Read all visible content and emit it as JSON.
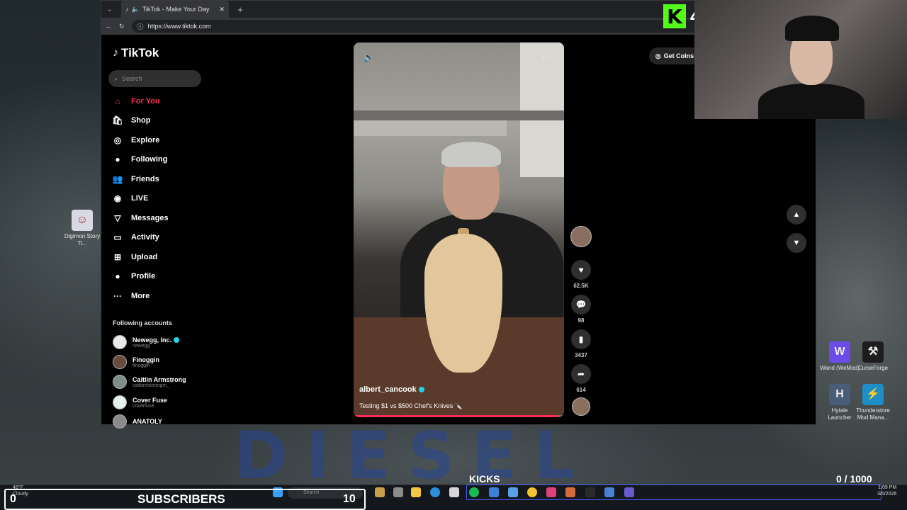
{
  "browser": {
    "tab_title": "TikTok - Make Your Day",
    "url": "https://www.tiktok.com"
  },
  "sidebar": {
    "logo": "TikTok",
    "search_placeholder": "Search",
    "nav": [
      {
        "label": "For You",
        "icon": "home-icon"
      },
      {
        "label": "Shop",
        "icon": "shop-bag-icon"
      },
      {
        "label": "Explore",
        "icon": "compass-icon"
      },
      {
        "label": "Following",
        "icon": "avatar-icon"
      },
      {
        "label": "Friends",
        "icon": "friends-icon"
      },
      {
        "label": "LIVE",
        "icon": "live-icon"
      },
      {
        "label": "Messages",
        "icon": "paper-plane-icon"
      },
      {
        "label": "Activity",
        "icon": "inbox-icon"
      },
      {
        "label": "Upload",
        "icon": "plus-square-icon"
      },
      {
        "label": "Profile",
        "icon": "avatar-icon"
      },
      {
        "label": "More",
        "icon": "ellipsis-icon"
      }
    ],
    "following_title": "Following accounts",
    "accounts": [
      {
        "name": "Newegg, Inc.",
        "handle": "newegg"
      },
      {
        "name": "Finoggin",
        "handle": "finoggin"
      },
      {
        "name": "Caitlin Armstrong",
        "handle": "caitarmstrongm_"
      },
      {
        "name": "Cover Fuse",
        "handle": "coverfuse"
      },
      {
        "name": "ANATOLY",
        "handle": ""
      }
    ]
  },
  "video": {
    "author": "albert_cancook",
    "caption": "Testing $1 vs $500 Chef's Knives 🔪",
    "progress": 0.97
  },
  "actions": {
    "likes": "62.5K",
    "comments": "98",
    "saves": "3437",
    "shares": "614"
  },
  "get_coins": "Get Coins",
  "overlay": {
    "kick_logo": "K",
    "kick_count": "4",
    "subs_left": "0",
    "subs_label": "SUBSCRIBERS",
    "subs_right": "10",
    "kicks_label": "KICKS",
    "kicks_count": "0  / 1000"
  },
  "desktop": {
    "wallpaper_word": "DIESEL",
    "icons": [
      {
        "label": "Digimon Story Ti..."
      },
      {
        "label": "Wand (WeMod)"
      },
      {
        "label": "CurseForge"
      },
      {
        "label": "Hytale Launcher"
      },
      {
        "label": "Thunderstore Mod Mana..."
      }
    ]
  },
  "taskbar": {
    "weather_temp": "48°F",
    "weather_text": "Cloudy",
    "search_placeholder": "Search",
    "time": "1:09 PM",
    "date": "3/5/2026"
  },
  "colors": {
    "accent": "#fe2c55",
    "kick_green": "#53fc18",
    "verified": "#20d5ec"
  }
}
